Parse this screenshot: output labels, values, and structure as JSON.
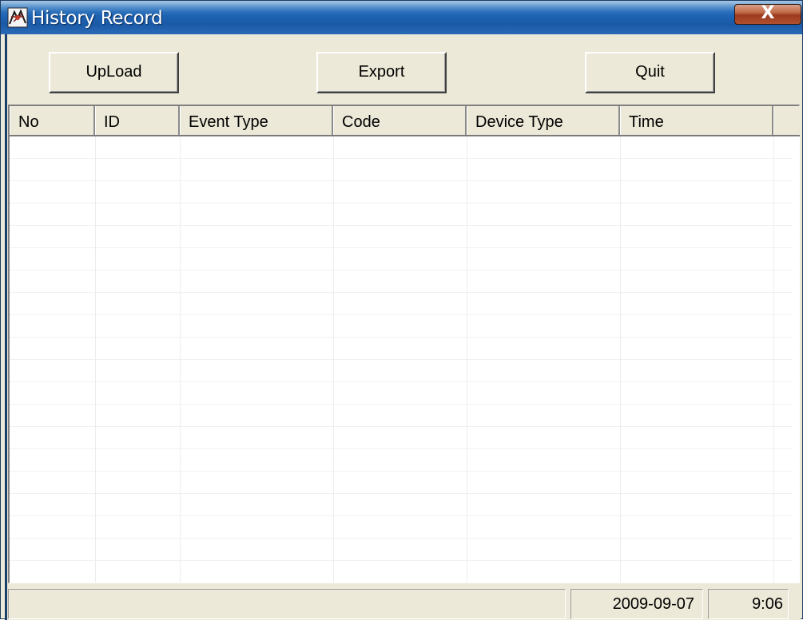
{
  "window": {
    "title": "History Record",
    "close_label": "X"
  },
  "toolbar": {
    "upload_label": "UpLoad",
    "export_label": "Export",
    "quit_label": "Quit"
  },
  "table": {
    "columns": [
      "No",
      "ID",
      "Event Type",
      "Code",
      "Device Type",
      "Time"
    ],
    "rows": []
  },
  "status": {
    "message": "",
    "date": "2009-09-07",
    "time": "9:06"
  }
}
